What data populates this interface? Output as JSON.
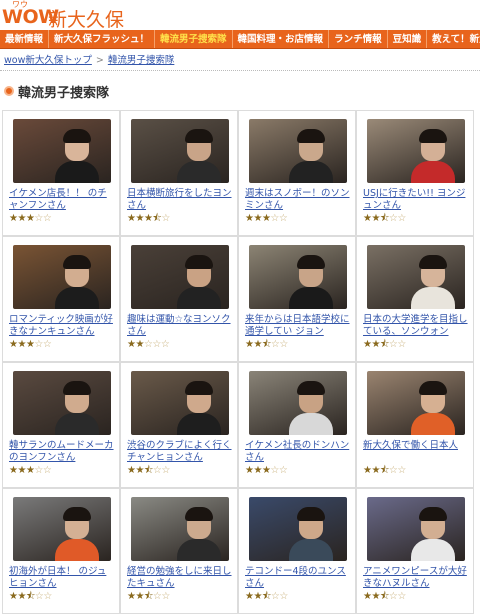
{
  "logo": {
    "wow": "WOW",
    "name": "新大久保",
    "ruby": "ワウ"
  },
  "nav": [
    {
      "label": "最新情報",
      "active": false
    },
    {
      "label": "新大久保フラッシュ！",
      "active": false
    },
    {
      "label": "韓流男子捜索隊",
      "active": true
    },
    {
      "label": "韓国料理・お店情報",
      "active": false
    },
    {
      "label": "ランチ情報",
      "active": false
    },
    {
      "label": "豆知識",
      "active": false
    },
    {
      "label": "教えて！新大久保",
      "active": false
    }
  ],
  "breadcrumb": {
    "home": "wow新大久保トップ",
    "sep": ">",
    "current": "韓流男子捜索隊"
  },
  "page_title": "韓流男子捜索隊",
  "colors": {
    "accent": "#e8641c",
    "link": "#3355aa",
    "star": "#8a6a1e"
  },
  "items": [
    {
      "caption": "イケメン店長！！ のチャンフンさん",
      "rating": 3,
      "scene": "#6a4a3a",
      "skin": "#d9b59a",
      "shirt": "#1a1a1a"
    },
    {
      "caption": "日本横断旅行をしたヨンさん",
      "rating": 3.5,
      "scene": "#5a5046",
      "skin": "#c9a488",
      "shirt": "#2a2a2a"
    },
    {
      "caption": "週末はスノボー！のソンミンさん",
      "rating": 3,
      "scene": "#8a7a68",
      "skin": "#caa88c",
      "shirt": "#222"
    },
    {
      "caption": "USJに行きたい!! ヨンジュンさん",
      "rating": 2.5,
      "scene": "#9a8a78",
      "skin": "#d4b096",
      "shirt": "#c42a2a"
    },
    {
      "caption": "ロマンティック映画が好きなナンキュンさん",
      "rating": 3,
      "scene": "#7a5434",
      "skin": "#d2ad90",
      "shirt": "#1c1c1c"
    },
    {
      "caption": "趣味は運動☆なヨンソクさん",
      "rating": 2,
      "scene": "#4a4038",
      "skin": "#c9a284",
      "shirt": "#222"
    },
    {
      "caption": "来年からは日本語学校に通学してい ジョン",
      "rating": 2.5,
      "scene": "#8c8474",
      "skin": "#c8a488",
      "shirt": "#1a1a1a"
    },
    {
      "caption": "日本の大学進学を目指している、ソンウォン",
      "rating": 2.5,
      "scene": "#7a7064",
      "skin": "#d6b49a",
      "shirt": "#e8e4dc"
    },
    {
      "caption": "韓サランのムードメーカのヨンフンさん",
      "rating": 3,
      "scene": "#5a4a40",
      "skin": "#d0ab8e",
      "shirt": "#2a2a2a"
    },
    {
      "caption": "渋谷のクラブによく行くチャンヒョンさん",
      "rating": 2.5,
      "scene": "#6a5a4a",
      "skin": "#cfa98c",
      "shirt": "#1e1e1e"
    },
    {
      "caption": "イケメン社長のドンハンさん",
      "rating": 3,
      "scene": "#8a8478",
      "skin": "#c8a284",
      "shirt": "#d8d8d8"
    },
    {
      "caption": "新大久保で働く日本人",
      "rating": 2.5,
      "scene": "#9a8470",
      "skin": "#d6b092",
      "shirt": "#e06028"
    },
    {
      "caption": "初海外が日本！ のジュヒョンさん",
      "rating": 2.5,
      "scene": "#7a7a7a",
      "skin": "#d4b094",
      "shirt": "#e05a28"
    },
    {
      "caption": "経営の勉強をしに来日したキュさん",
      "rating": 2.5,
      "scene": "#8a8a84",
      "skin": "#ccaa8e",
      "shirt": "#2a2a2a"
    },
    {
      "caption": "テコンドー4段のユンスさん",
      "rating": 2.5,
      "scene": "#3a4a6a",
      "skin": "#cea88a",
      "shirt": "#3a4a5a"
    },
    {
      "caption": "アニメワンピースが大好きなハヌルさん",
      "rating": 2.5,
      "scene": "#6a6a8a",
      "skin": "#d2ae92",
      "shirt": "#e8e8e8"
    }
  ]
}
